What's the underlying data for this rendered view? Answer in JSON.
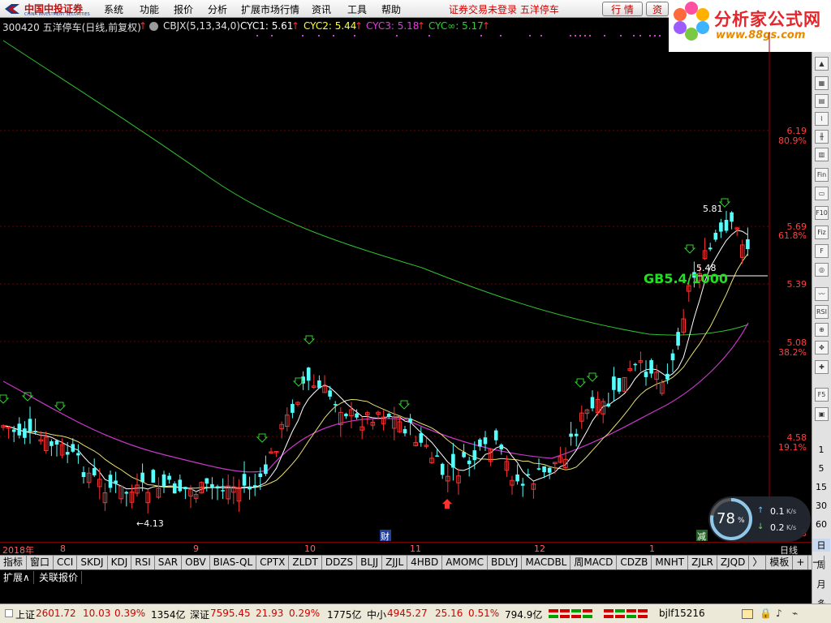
{
  "menubar": {
    "logo_text": "中国中投证券",
    "logo_sub": "CHINA INVESTMENT SECURITIES",
    "items": [
      "系统",
      "功能",
      "报价",
      "分析",
      "扩展市场行情",
      "资讯",
      "工具",
      "帮助"
    ],
    "login_status": "证券交易未登录",
    "stock_status": "五洋停车",
    "btn_quote": "行 情",
    "btn_info": "资"
  },
  "brand": {
    "title": "分析家公式网",
    "url": "www.88gs.com"
  },
  "info": {
    "code_name": "300420 五洋停车(日线,前复权)",
    "indicator": "CBJX(5,13,34,0)",
    "cyc1": "CYC1: 5.61",
    "cyc2": "CYC2: 5.44",
    "cyc3": "CYC3: 5.18",
    "cycinf": "CYC∞: 5.17",
    "arrow": "↑"
  },
  "price_axis": [
    {
      "value": "6.19",
      "pct": "80.9%"
    },
    {
      "value": "5.69",
      "pct": "61.8%"
    },
    {
      "value": "5.39",
      "pct": ""
    },
    {
      "value": "5.08",
      "pct": "38.2%"
    },
    {
      "value": "4.58",
      "pct": "19.1%"
    },
    {
      "value": "",
      "pct": "8"
    }
  ],
  "annotations": {
    "low": "←4.13",
    "high": "5.81",
    "mid": "5.48",
    "gb": "GB5.4/1000",
    "cai": "财",
    "jian": "减"
  },
  "dates": {
    "year": "2018年",
    "m8": "8",
    "m9": "9",
    "m10": "10",
    "m11": "11",
    "m12": "12",
    "m1": "1",
    "period": "日线"
  },
  "tabs": [
    "指标",
    "窗口",
    "CCI",
    "SKDJ",
    "KDJ",
    "RSI",
    "SAR",
    "OBV",
    "BIAS-QL",
    "CPTX",
    "ZLDT",
    "DDZS",
    "BLJJ",
    "ZJJL",
    "4HBD",
    "AMOMC",
    "BDLYJ",
    "MACDBL",
    "周MACD",
    "CDZB",
    "MNHT",
    "ZJLR",
    "ZJQD",
    "〉",
    "模板",
    "+",
    "−"
  ],
  "ext_tabs": [
    "扩展∧",
    "关联报价"
  ],
  "speed": {
    "pct": "78",
    "unit": "%",
    "up": "0.1",
    "down": "0.2",
    "rate_unit": "K/s"
  },
  "right_tools": {
    "nums": [
      "1",
      "5",
      "15",
      "30",
      "60",
      "日",
      "周",
      "月",
      "多"
    ]
  },
  "status": {
    "sh_label": "上证",
    "sh_val": "2601.72",
    "sh_chg": "10.03",
    "sh_pct": "0.39%",
    "sh_amt": "1354亿",
    "sz_label": "深证",
    "sz_val": "7595.45",
    "sz_chg": "21.93",
    "sz_pct": "0.29%",
    "sz_amt": "1775亿",
    "zx_label": "中小",
    "zx_val": "4945.27",
    "zx_chg": "25.16",
    "zx_pct": "0.51%",
    "zx_amt": "794.9亿",
    "user": "bjlf15216"
  },
  "colors": {
    "up": "#ff3232",
    "down": "#54ffff",
    "ma_slow": "#30c030",
    "ma_mid": "#c838c8",
    "accent": "#d40000"
  }
}
